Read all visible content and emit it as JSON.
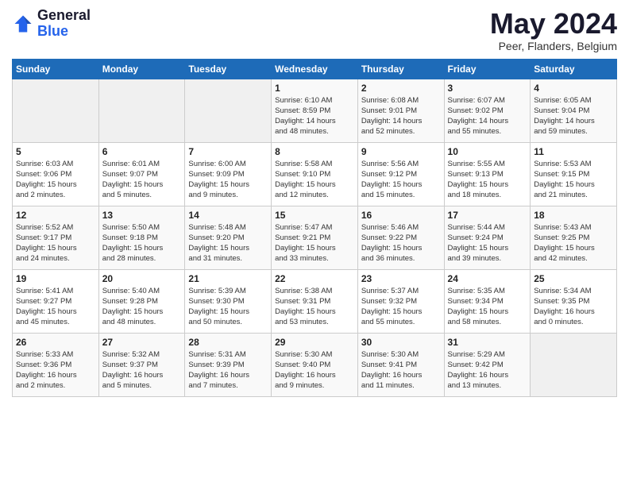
{
  "header": {
    "logo_general": "General",
    "logo_blue": "Blue",
    "month_title": "May 2024",
    "location": "Peer, Flanders, Belgium"
  },
  "days_of_week": [
    "Sunday",
    "Monday",
    "Tuesday",
    "Wednesday",
    "Thursday",
    "Friday",
    "Saturday"
  ],
  "weeks": [
    [
      {
        "day": "",
        "info": ""
      },
      {
        "day": "",
        "info": ""
      },
      {
        "day": "",
        "info": ""
      },
      {
        "day": "1",
        "info": "Sunrise: 6:10 AM\nSunset: 8:59 PM\nDaylight: 14 hours\nand 48 minutes."
      },
      {
        "day": "2",
        "info": "Sunrise: 6:08 AM\nSunset: 9:01 PM\nDaylight: 14 hours\nand 52 minutes."
      },
      {
        "day": "3",
        "info": "Sunrise: 6:07 AM\nSunset: 9:02 PM\nDaylight: 14 hours\nand 55 minutes."
      },
      {
        "day": "4",
        "info": "Sunrise: 6:05 AM\nSunset: 9:04 PM\nDaylight: 14 hours\nand 59 minutes."
      }
    ],
    [
      {
        "day": "5",
        "info": "Sunrise: 6:03 AM\nSunset: 9:06 PM\nDaylight: 15 hours\nand 2 minutes."
      },
      {
        "day": "6",
        "info": "Sunrise: 6:01 AM\nSunset: 9:07 PM\nDaylight: 15 hours\nand 5 minutes."
      },
      {
        "day": "7",
        "info": "Sunrise: 6:00 AM\nSunset: 9:09 PM\nDaylight: 15 hours\nand 9 minutes."
      },
      {
        "day": "8",
        "info": "Sunrise: 5:58 AM\nSunset: 9:10 PM\nDaylight: 15 hours\nand 12 minutes."
      },
      {
        "day": "9",
        "info": "Sunrise: 5:56 AM\nSunset: 9:12 PM\nDaylight: 15 hours\nand 15 minutes."
      },
      {
        "day": "10",
        "info": "Sunrise: 5:55 AM\nSunset: 9:13 PM\nDaylight: 15 hours\nand 18 minutes."
      },
      {
        "day": "11",
        "info": "Sunrise: 5:53 AM\nSunset: 9:15 PM\nDaylight: 15 hours\nand 21 minutes."
      }
    ],
    [
      {
        "day": "12",
        "info": "Sunrise: 5:52 AM\nSunset: 9:17 PM\nDaylight: 15 hours\nand 24 minutes."
      },
      {
        "day": "13",
        "info": "Sunrise: 5:50 AM\nSunset: 9:18 PM\nDaylight: 15 hours\nand 28 minutes."
      },
      {
        "day": "14",
        "info": "Sunrise: 5:48 AM\nSunset: 9:20 PM\nDaylight: 15 hours\nand 31 minutes."
      },
      {
        "day": "15",
        "info": "Sunrise: 5:47 AM\nSunset: 9:21 PM\nDaylight: 15 hours\nand 33 minutes."
      },
      {
        "day": "16",
        "info": "Sunrise: 5:46 AM\nSunset: 9:22 PM\nDaylight: 15 hours\nand 36 minutes."
      },
      {
        "day": "17",
        "info": "Sunrise: 5:44 AM\nSunset: 9:24 PM\nDaylight: 15 hours\nand 39 minutes."
      },
      {
        "day": "18",
        "info": "Sunrise: 5:43 AM\nSunset: 9:25 PM\nDaylight: 15 hours\nand 42 minutes."
      }
    ],
    [
      {
        "day": "19",
        "info": "Sunrise: 5:41 AM\nSunset: 9:27 PM\nDaylight: 15 hours\nand 45 minutes."
      },
      {
        "day": "20",
        "info": "Sunrise: 5:40 AM\nSunset: 9:28 PM\nDaylight: 15 hours\nand 48 minutes."
      },
      {
        "day": "21",
        "info": "Sunrise: 5:39 AM\nSunset: 9:30 PM\nDaylight: 15 hours\nand 50 minutes."
      },
      {
        "day": "22",
        "info": "Sunrise: 5:38 AM\nSunset: 9:31 PM\nDaylight: 15 hours\nand 53 minutes."
      },
      {
        "day": "23",
        "info": "Sunrise: 5:37 AM\nSunset: 9:32 PM\nDaylight: 15 hours\nand 55 minutes."
      },
      {
        "day": "24",
        "info": "Sunrise: 5:35 AM\nSunset: 9:34 PM\nDaylight: 15 hours\nand 58 minutes."
      },
      {
        "day": "25",
        "info": "Sunrise: 5:34 AM\nSunset: 9:35 PM\nDaylight: 16 hours\nand 0 minutes."
      }
    ],
    [
      {
        "day": "26",
        "info": "Sunrise: 5:33 AM\nSunset: 9:36 PM\nDaylight: 16 hours\nand 2 minutes."
      },
      {
        "day": "27",
        "info": "Sunrise: 5:32 AM\nSunset: 9:37 PM\nDaylight: 16 hours\nand 5 minutes."
      },
      {
        "day": "28",
        "info": "Sunrise: 5:31 AM\nSunset: 9:39 PM\nDaylight: 16 hours\nand 7 minutes."
      },
      {
        "day": "29",
        "info": "Sunrise: 5:30 AM\nSunset: 9:40 PM\nDaylight: 16 hours\nand 9 minutes."
      },
      {
        "day": "30",
        "info": "Sunrise: 5:30 AM\nSunset: 9:41 PM\nDaylight: 16 hours\nand 11 minutes."
      },
      {
        "day": "31",
        "info": "Sunrise: 5:29 AM\nSunset: 9:42 PM\nDaylight: 16 hours\nand 13 minutes."
      },
      {
        "day": "",
        "info": ""
      }
    ]
  ]
}
